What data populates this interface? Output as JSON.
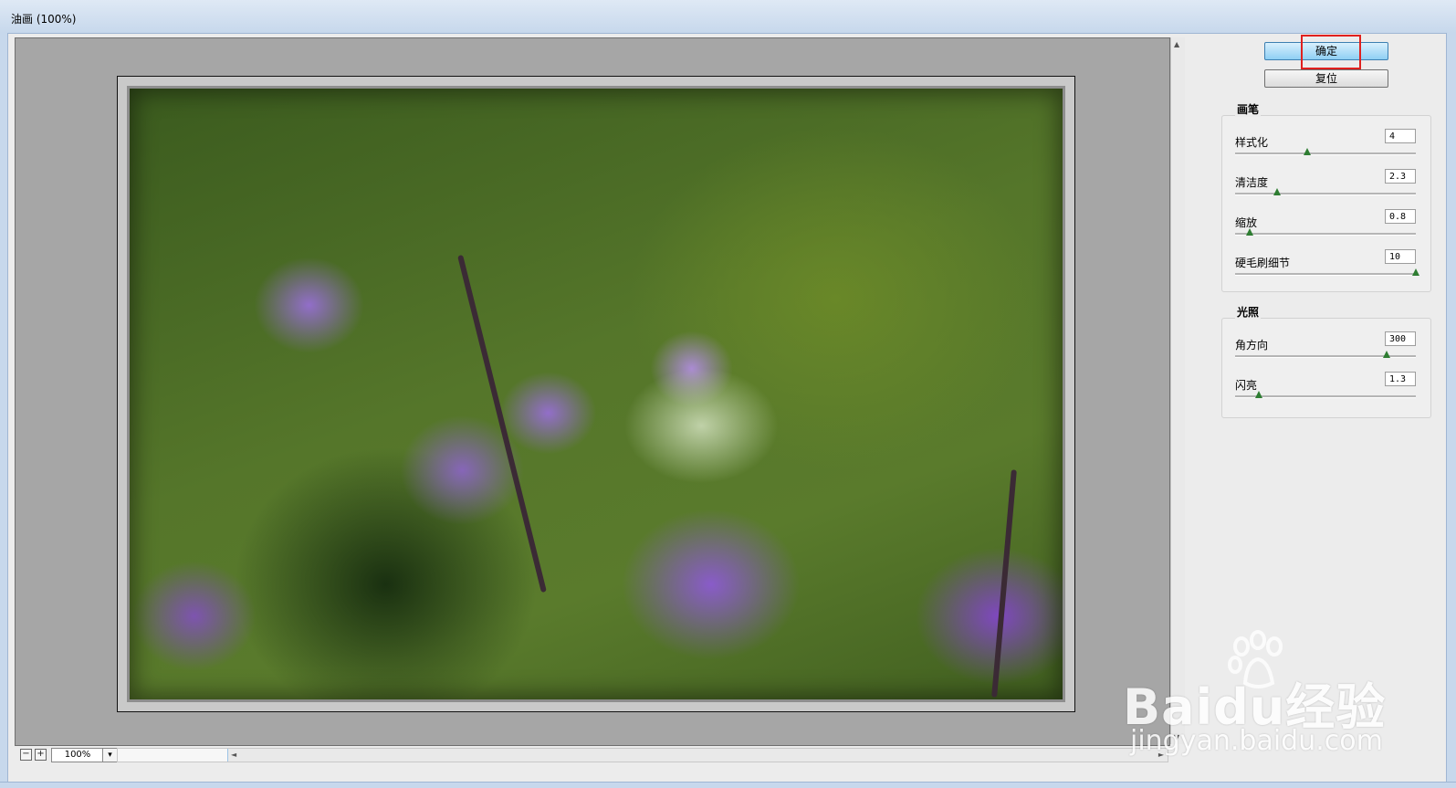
{
  "window": {
    "title": "油画 (100%)"
  },
  "buttons": {
    "ok": "确定",
    "reset": "复位"
  },
  "brush": {
    "title": "画笔",
    "rows": [
      {
        "label": "样式化",
        "value": "4",
        "fraction": 0.4
      },
      {
        "label": "清洁度",
        "value": "2.3",
        "fraction": 0.23
      },
      {
        "label": "缩放",
        "value": "0.8",
        "fraction": 0.08
      },
      {
        "label": "硬毛刷细节",
        "value": "10",
        "fraction": 1.0
      }
    ]
  },
  "lighting": {
    "title": "光照",
    "rows": [
      {
        "label": "角方向",
        "value": "300",
        "fraction": 0.84
      },
      {
        "label": "闪亮",
        "value": "1.3",
        "fraction": 0.13
      }
    ]
  },
  "zoom": {
    "value": "100%",
    "minus": "−",
    "plus": "+",
    "dropdown": "▾"
  },
  "watermark": {
    "brand": "Baidu经验",
    "url": "jingyan.baidu.com"
  },
  "colors": {
    "ok_button": "#8fcff4",
    "highlight": "#e0201e",
    "slider_knob": "#2e7d32"
  }
}
